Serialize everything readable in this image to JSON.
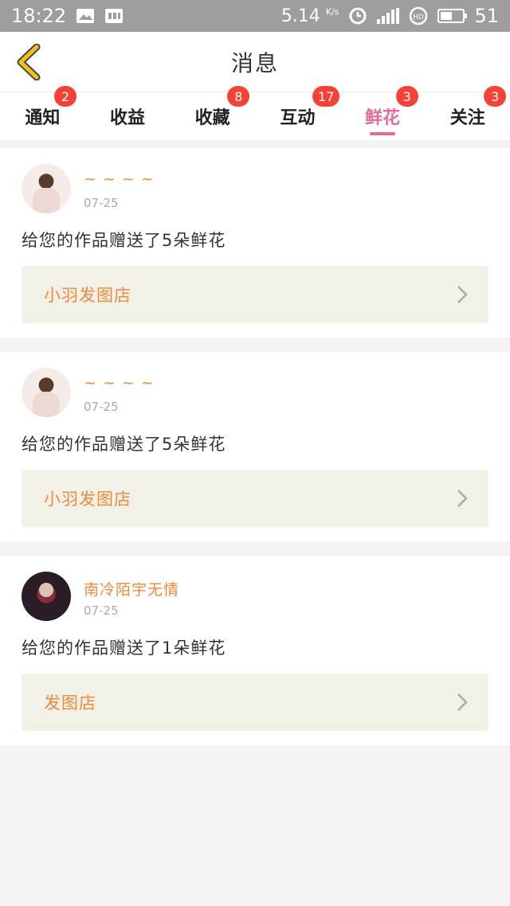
{
  "status_bar": {
    "time": "18:22",
    "speed": "5.14",
    "speed_unit": "K/s",
    "battery": "51"
  },
  "header": {
    "title": "消息"
  },
  "tabs": [
    {
      "label": "通知",
      "badge": "2"
    },
    {
      "label": "收益",
      "badge": ""
    },
    {
      "label": "收藏",
      "badge": "8"
    },
    {
      "label": "互动",
      "badge": "17"
    },
    {
      "label": "鲜花",
      "badge": "3",
      "active": true
    },
    {
      "label": "关注",
      "badge": "3"
    }
  ],
  "messages": [
    {
      "sender": "~ ~ ~ ~",
      "date": "07-25",
      "text": "给您的作品赠送了5朵鲜花",
      "shop": "小羽发图店",
      "avatar": "light"
    },
    {
      "sender": "~ ~ ~ ~",
      "date": "07-25",
      "text": "给您的作品赠送了5朵鲜花",
      "shop": "小羽发图店",
      "avatar": "light"
    },
    {
      "sender": "南冷陌宇无情",
      "date": "07-25",
      "text": "给您的作品赠送了1朵鲜花",
      "shop": "发图店",
      "avatar": "dark"
    }
  ],
  "colors": {
    "accent_pink": "#e36b9a",
    "accent_orange": "#ef8a3d",
    "badge_red": "#f44336",
    "back_icon_yellow": "#f2c21b"
  }
}
